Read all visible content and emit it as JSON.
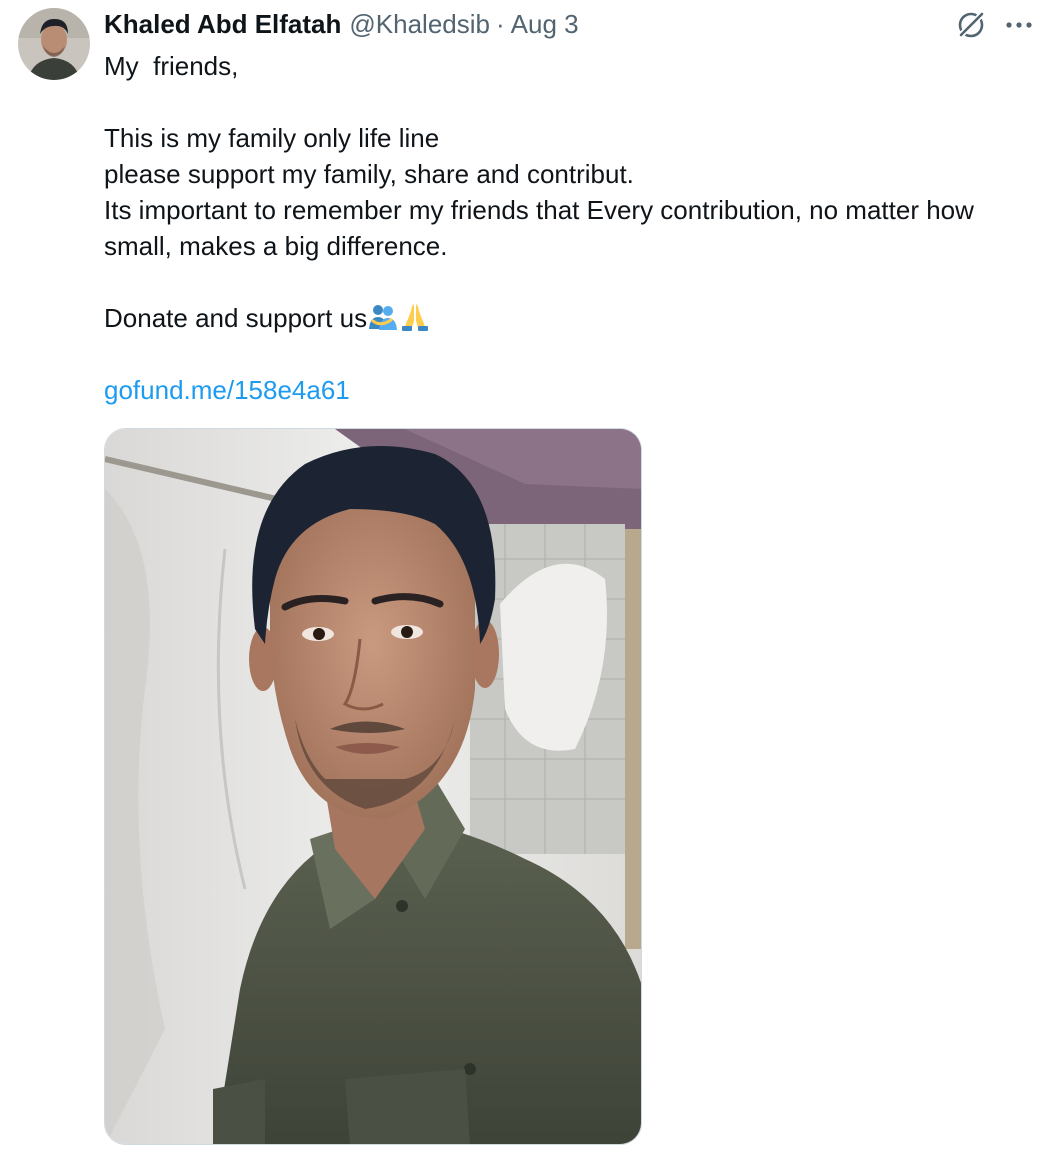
{
  "tweet": {
    "author": {
      "display_name": "Khaled Abd Elfatah",
      "handle": "@Khaledsib",
      "avatar_icon": "profile-photo"
    },
    "separator": "·",
    "date": "Aug 3",
    "header_icons": [
      "grok-icon",
      "more-icon"
    ],
    "body": {
      "line_1": "My  friends,",
      "line_2": "This is my family only life line",
      "line_3": "please support my family, share and contribut.",
      "line_4": "Its important to remember my friends that Every contribution, no matter how small, makes a big difference.",
      "line_5": "Donate and support us",
      "emojis": [
        "people-hugging",
        "folded-hands"
      ],
      "link": "gofund.me/158e4a61"
    },
    "media": {
      "type": "photo",
      "subject": "man-selfie-photo"
    },
    "colors": {
      "link": "#1d9bf0",
      "secondary_text": "#536471",
      "primary_text": "#0f1419"
    }
  }
}
